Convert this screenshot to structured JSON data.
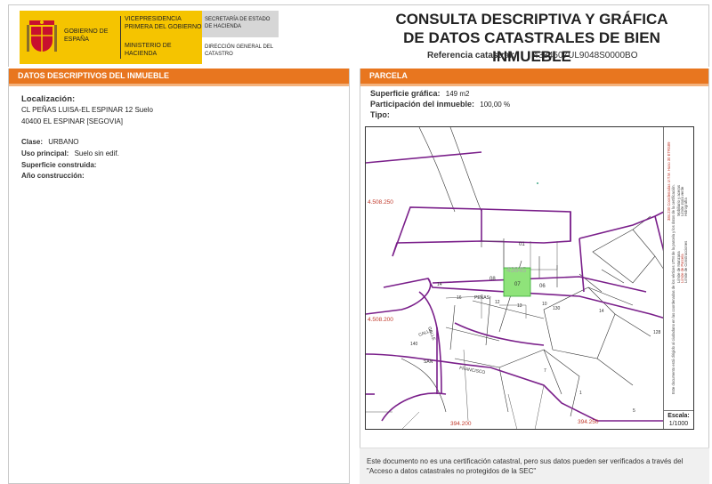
{
  "header": {
    "logo": {
      "country": "GOBIERNO DE ESPAÑA",
      "vicepresidency": "VICEPRESIDENCIA PRIMERA DEL GOBIERNO",
      "ministry": "MINISTERIO DE HACIENDA",
      "secretariat": "SECRETARÍA DE ESTADO DE HACIENDA",
      "directorate": "DIRECCIÓN GENERAL DEL CATASTRO"
    },
    "title_line1": "CONSULTA DESCRIPTIVA Y GRÁFICA",
    "title_line2": "DE DATOS CATASTRALES DE BIEN INMUEBLE",
    "ref_label": "Referencia catastral:",
    "ref_value": "4384507UL9048S0000BO"
  },
  "left": {
    "bar_title": "DATOS DESCRIPTIVOS DEL INMUEBLE",
    "localizacion_label": "Localización:",
    "address_line1": "CL PEÑAS LUISA-EL ESPINAR 12 Suelo",
    "address_line2": "40400 EL ESPINAR [SEGOVIA]",
    "clase_label": "Clase:",
    "clase_value": "URBANO",
    "uso_label": "Uso principal:",
    "uso_value": "Suelo sin edif.",
    "superficie_label": "Superficie construida:",
    "anio_label": "Año construcción:"
  },
  "right": {
    "bar_title": "PARCELA",
    "sup_grafica_label": "Superficie gráfica:",
    "sup_grafica_value": "149 m2",
    "participacion_label": "Participación del inmueble:",
    "participacion_value": "100,00 %",
    "tipo_label": "Tipo:"
  },
  "map": {
    "coord_top": "4.508.250",
    "coord_mid": "4.508.200",
    "coord_bottom_x1": "394.200",
    "coord_bottom_x2": "394.250",
    "parcel_ref": "43845",
    "labels": {
      "p01": "01",
      "p08": "08",
      "p07": "07",
      "p06": "06",
      "penas": "PEÑAS",
      "calle": "CALLE",
      "calle2": "CALLE",
      "n14a": "14",
      "n16": "16",
      "n12": "12",
      "n13": "13",
      "n10": "10",
      "n14b": "14",
      "n130": "130",
      "n128": "128",
      "n1": "1",
      "san": "SAN",
      "francisco": "FRANCISCO",
      "n7": "7",
      "n140": "140",
      "n5": "5"
    },
    "legend": {
      "l1": "Límite de Manzana",
      "l2": "Límite de Parcela",
      "l3": "Límite de Construcciones",
      "l4": "Mobiliario y aceras",
      "l5": "Límite zona verde",
      "l6": "Hidrografía",
      "red1": "384.230 Coordenadas U.T.M. Huso 30 ETRS89",
      "info": "Este documento está dirigido al ciudadano en las coordenadas de los vértices UTM de la parcela y los datos de la certificación."
    },
    "scale_label": "Escala:",
    "scale_value": "1/1000"
  },
  "footer": {
    "note": "Este documento no es una certificación catastral, pero sus datos pueden ser verificados a través del \"Acceso a datos catastrales no protegidos de la SEC\""
  },
  "colors": {
    "orange_bar": "#e8761f",
    "logo_yellow": "#f5c400",
    "parcel_line": "#7a1f8a",
    "parcel_highlight": "#8fe37a"
  }
}
